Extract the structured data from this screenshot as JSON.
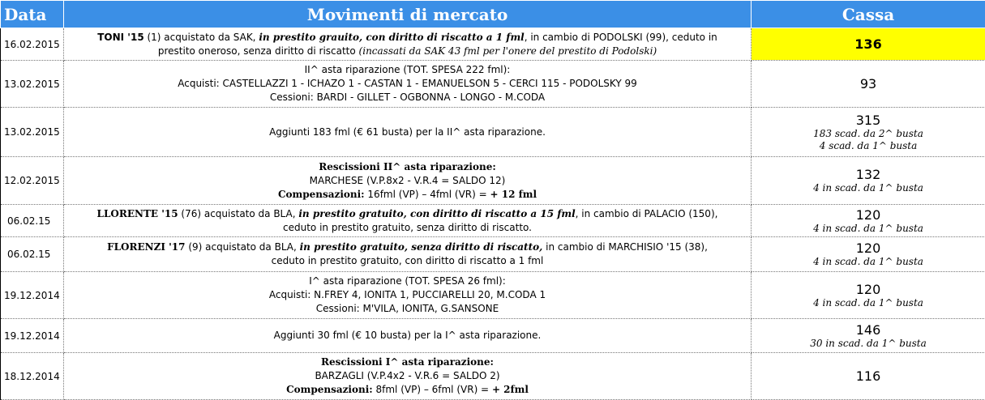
{
  "header": {
    "date": "Data",
    "movements": "Movimenti di mercato",
    "cassa": "Cassa"
  },
  "rows": [
    {
      "date": "16.02.2015",
      "l1_player": "TONI '15",
      "l1_a": " (1) acquistato da SAK, ",
      "l1_b": "in prestito grauito, con diritto di riscatto a 1 fml",
      "l1_c": ", in cambio di PODOLSKI (99), ceduto in",
      "l2_a": "prestito oneroso, senza diritto di riscatto ",
      "l2_b": "(incassati da SAK 43 fml per l'onere del prestito di Podolski)",
      "cassa": "136"
    },
    {
      "date": "13.02.2015",
      "l1": "II^ asta riparazione (TOT. SPESA 222 fml):",
      "l2": "Acquisti: CASTELLAZZI 1 - ICHAZO 1 - CASTAN 1 - EMANUELSON 5 - CERCI 115 - PODOLSKY 99",
      "l3": "Cessioni: BARDI - GILLET - OGBONNA - LONGO - M.CODA",
      "cassa": "93"
    },
    {
      "date": "13.02.2015",
      "l1": "Aggiunti 183 fml (€ 61 busta) per la II^ asta riparazione.",
      "cassa": "315",
      "note1": "183 scad. da 2^ busta",
      "note2": "4 scad. da 1^ busta"
    },
    {
      "date": "12.02.2015",
      "l1": "Rescissioni II^ asta riparazione:",
      "l2": "MARCHESE (V.P.8x2 - V.R.4 = SALDO 12)",
      "l3_label": "Compensazioni:",
      "l3_text": " 16fml (VP) – 4fml (VR) = ",
      "l3_result": "+ 12 fml",
      "cassa": "132",
      "note1": "4 in scad. da 1^ busta"
    },
    {
      "date": "06.02.15",
      "l1_player": "LLORENTE '15",
      "l1_a": " (76) acquistato da BLA, ",
      "l1_b": "in prestito gratuito, con diritto di riscatto a 15 fml",
      "l1_c": ", in cambio di PALACIO (150),",
      "l2": "ceduto in  prestito gratuito, senza diritto di riscatto.",
      "cassa": "120",
      "note1": "4 in scad. da 1^ busta"
    },
    {
      "date": "06.02.15",
      "l1_player": "FLORENZI '17",
      "l1_a": " (9) acquistato da BLA, ",
      "l1_b": "in prestito gratuito, senza diritto di riscatto,",
      "l1_c": " in cambio di MARCHISIO '15 (38),",
      "l2": "ceduto in  prestito gratuito, con diritto di riscatto a 1 fml",
      "cassa": "120",
      "note1": "4 in scad. da 1^ busta"
    },
    {
      "date": "19.12.2014",
      "l1": "I^ asta riparazione (TOT. SPESA 26 fml):",
      "l2": "Acquisti: N.FREY 4, IONITA 1, PUCCIARELLI 20, M.CODA 1",
      "l3": "Cessioni: M'VILA, IONITA, G.SANSONE",
      "cassa": "120",
      "note1": "4 in scad. da 1^ busta"
    },
    {
      "date": "19.12.2014",
      "l1": "Aggiunti 30 fml (€ 10 busta) per la I^ asta riparazione.",
      "cassa": "146",
      "note1": "30 in scad. da 1^ busta"
    },
    {
      "date": "18.12.2014",
      "l1": "Rescissioni I^ asta riparazione:",
      "l2": "BARZAGLI (V.P.4x2 - V.R.6 = SALDO 2)",
      "l3_label": "Compensazioni:",
      "l3_text": " 8fml (VP) – 6fml (VR) = ",
      "l3_result": "+ 2fml",
      "cassa": "116"
    }
  ],
  "colors": {
    "header_bg": "#3b8fe6",
    "highlight": "#ffff00"
  }
}
